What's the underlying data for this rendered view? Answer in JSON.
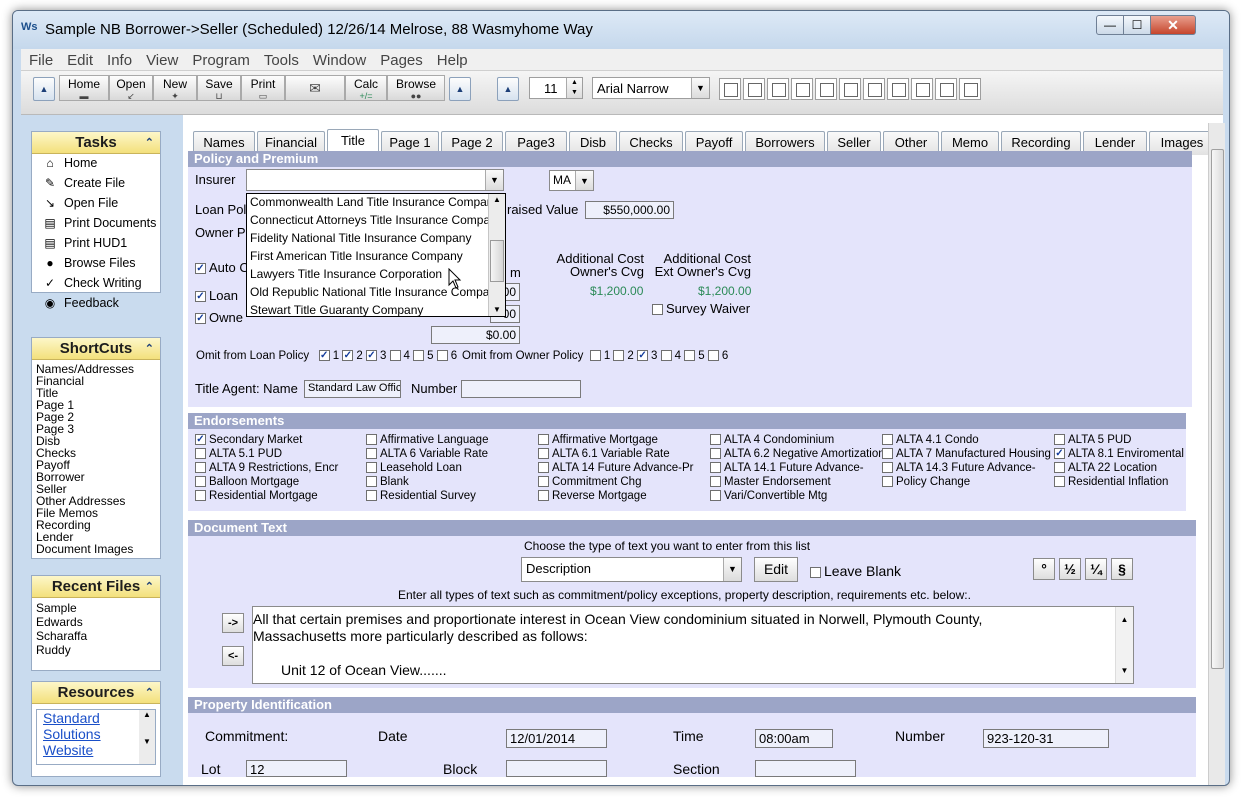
{
  "window": {
    "title": "Sample NB Borrower->Seller (Scheduled) 12/26/14 Melrose, 88 Wasmyhome Way",
    "app_icon": "Ws",
    "minimize_glyph": "—",
    "maximize_glyph": "☐",
    "close_glyph": "✕"
  },
  "menu": [
    "File",
    "Edit",
    "Info",
    "View",
    "Program",
    "Tools",
    "Window",
    "Pages",
    "Help"
  ],
  "toolbar": {
    "buttons": [
      "Home",
      "Open",
      "New",
      "Save",
      "Print",
      "Calc",
      "Browse"
    ],
    "font_size": "11",
    "font_name": "Arial Narrow"
  },
  "sidebar": {
    "tasks_title": "Tasks",
    "tasks": [
      "Home",
      "Create File",
      "Open File",
      "Print Documents",
      "Print HUD1",
      "Browse Files",
      "Check Writing",
      "Feedback"
    ],
    "shortcuts_title": "ShortCuts",
    "shortcuts": [
      "Names/Addresses",
      "Financial",
      "Title",
      "Page 1",
      "Page 2",
      "Page 3",
      "Disb",
      "Checks",
      "Payoff",
      "Borrower",
      "Seller",
      "Other Addresses",
      "File Memos",
      "Recording",
      "Lender",
      "Document Images"
    ],
    "recent_title": "Recent Files",
    "recent": [
      "Sample",
      "Edwards",
      "Scharaffa",
      "Ruddy"
    ],
    "resources_title": "Resources",
    "resources_link": [
      "Standard",
      "Solutions",
      "Website"
    ]
  },
  "tabs": [
    "Names",
    "Financial",
    "Title",
    "Page 1",
    "Page 2",
    "Page3",
    "Disb",
    "Checks",
    "Payoff",
    "Borrowers",
    "Seller",
    "Other",
    "Memo",
    "Recording",
    "Lender",
    "Images"
  ],
  "policy": {
    "header": "Policy and Premium",
    "insurer_label": "Insurer",
    "insurer_value": "",
    "state_value": "MA",
    "loan_policy_label": "Loan Pol",
    "owner_policy_label": "Owner P",
    "appraised_label": "raised Value",
    "appraised_value": "$550,000.00",
    "auto_label": "Auto C",
    "loan_cb_label": "Loan",
    "owner_cb_label": "Owne",
    "col_m_label": "m",
    "add_cost_owner": [
      "Additional Cost",
      "Owner's Cvg"
    ],
    "add_cost_ext": [
      "Additional Cost",
      "Ext Owner's Cvg"
    ],
    "owner_cvg_value": "$1,200.00",
    "ext_cvg_value": "$1,200.00",
    "survey_waiver": "Survey Waiver",
    "field_a": "00",
    "field_b": "00",
    "total": "$0.00",
    "omit_loan_label": "Omit from Loan Policy",
    "omit_owner_label": "Omit from Owner Policy",
    "omit_nums": [
      "1",
      "2",
      "3",
      "4",
      "5",
      "6"
    ],
    "agent_label": "Title Agent:  Name",
    "agent_value": "Standard Law Office",
    "number_label": "Number",
    "number_value": ""
  },
  "insurer_options": [
    "Commonwealth Land Title Insurance Company",
    "Connecticut Attorneys Title Insurance Company",
    "Fidelity National Title Insurance Company",
    "First American Title Insurance Company",
    "Lawyers Title Insurance Corporation",
    "Old Republic National Title Insurance Company",
    "Stewart Title Guaranty Company"
  ],
  "endorsements": {
    "header": "Endorsements",
    "columns": [
      [
        "Secondary Market",
        "ALTA 5.1 PUD",
        "ALTA 9 Restrictions, Encr",
        "Balloon Mortgage",
        "Residential Mortgage"
      ],
      [
        "Affirmative Language",
        "ALTA 6 Variable Rate",
        "Leasehold Loan",
        "Blank",
        "Residential Survey"
      ],
      [
        "Affirmative Mortgage",
        "ALTA 6.1 Variable Rate",
        "ALTA 14 Future Advance-Pr",
        "Commitment Chg",
        "Reverse Mortgage"
      ],
      [
        "ALTA 4 Condominium",
        "ALTA 6.2 Negative Amortization",
        "ALTA 14.1 Future Advance-",
        "Master Endorsement",
        "Vari/Convertible Mtg"
      ],
      [
        "ALTA 4.1 Condo",
        "ALTA 7 Manufactured Housing",
        "ALTA 14.3 Future Advance-",
        "Policy Change"
      ],
      [
        "ALTA 5 PUD",
        "ALTA 8.1 Enviromental",
        "ALTA 22 Location",
        "Residential Inflation"
      ]
    ]
  },
  "document_text": {
    "header": "Document Text",
    "choose_label": "Choose the type of text you want to enter from this list",
    "type_value": "Description",
    "edit_label": "Edit",
    "leave_blank_label": "Leave Blank",
    "symbols": [
      "°",
      "½",
      "¼",
      "§"
    ],
    "instructions": "Enter all types of text such as commitment/policy exceptions, property description, requirements etc. below:.",
    "arrow_right": "->",
    "arrow_left": "<-",
    "lines": [
      "All that certain premises and proportionate interest in Ocean View condominium situated in Norwell,  Plymouth County,",
      "Massachusetts  more particularly described as follows:",
      "",
      "Unit 12 of Ocean View......."
    ]
  },
  "property": {
    "header": "Property Identification",
    "commitment_label": "Commitment:",
    "date_label": "Date",
    "date_value": "12/01/2014",
    "time_label": "Time",
    "time_value": "08:00am",
    "number_label": "Number",
    "number_value": "923-120-31",
    "lot_label": "Lot",
    "lot_value": "12",
    "block_label": "Block",
    "block_value": "",
    "section_label": "Section",
    "section_value": ""
  },
  "colors": {
    "section_bg": "#e4e4fb",
    "section_header": "#9ca5c7",
    "panel_header": "#f3e07c",
    "window_frame": "#c9dbee"
  }
}
